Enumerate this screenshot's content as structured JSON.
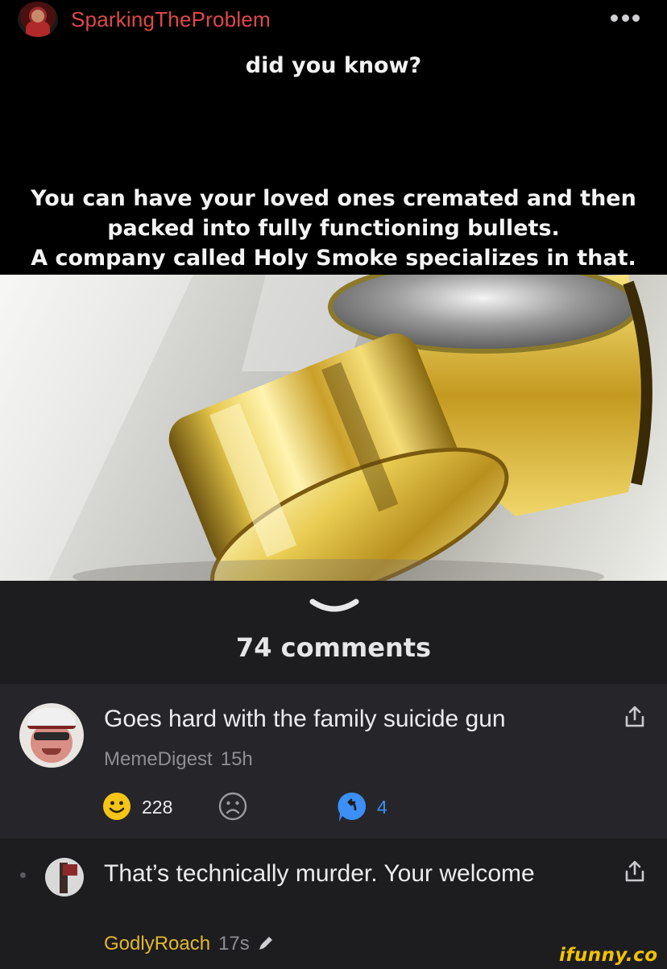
{
  "post": {
    "author": "SparkingTheProblem",
    "caption_top": "did you know?",
    "caption_lines": [
      "You can have your loved ones cremated and then",
      "packed into fully functioning bullets.",
      "A company called Holy Smoke specializes in that."
    ]
  },
  "comments_header": {
    "count_label": "74 comments"
  },
  "comments": [
    {
      "text": "Goes hard with the family suicide gun",
      "user": "MemeDigest",
      "time": "15h",
      "smiles": "228",
      "replies": "4"
    },
    {
      "text": "That’s technically murder. Your welcome",
      "user": "GodlyRoach",
      "time": "17s"
    }
  ],
  "watermark": "ifunny.co",
  "colors": {
    "author": "#e04848",
    "reply_accent": "#3c8ff6",
    "smile": "#f5c518",
    "reply_user": "#e3b82e",
    "watermark": "#f2c200"
  }
}
